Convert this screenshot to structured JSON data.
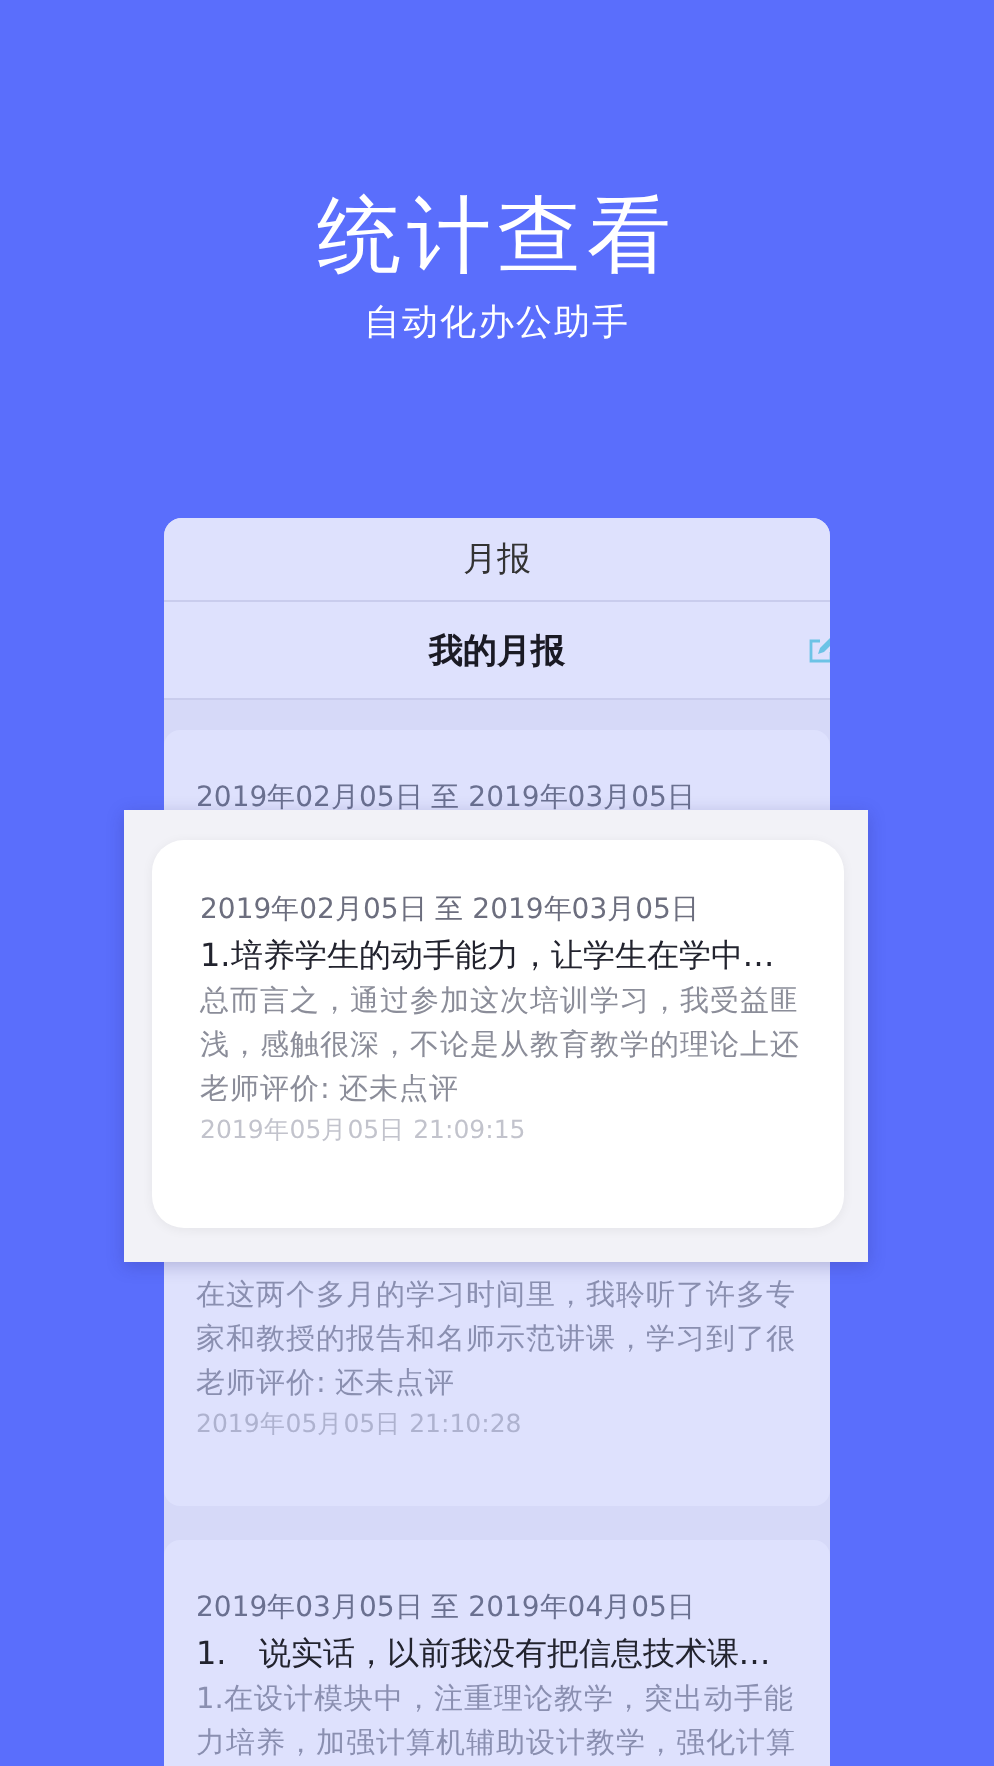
{
  "hero": {
    "title": "统计查看",
    "subtitle": "自动化办公助手"
  },
  "screen": {
    "header": "月报",
    "nav_title": "我的月报",
    "reports": [
      {
        "date_range": "2019年02月05日 至 2019年03月05日",
        "body": "在这两个多月的学习时间里，我聆听了许多专家和教授的报告和名师示范讲课，学习到了很",
        "review": "老师评价: 还未点评",
        "timestamp": "2019年05月05日 21:10:28"
      },
      {
        "date_range": "2019年03月05日 至 2019年04月05日",
        "title": "1.　说实话，以前我没有把信息技术课…",
        "body": "1.在设计模块中，注重理论教学，突出动手能力培养，加强计算机辅助设计教学，强化计算"
      }
    ]
  },
  "popup": {
    "date_range": "2019年02月05日 至 2019年03月05日",
    "title": "1.培养学生的动手能力，让学生在学中…",
    "body": "总而言之，通过参加这次培训学习，我受益匪浅，感触很深，不论是从教育教学的理论上还",
    "review": "老师评价: 还未点评",
    "timestamp": "2019年05月05日 21:09:15"
  }
}
